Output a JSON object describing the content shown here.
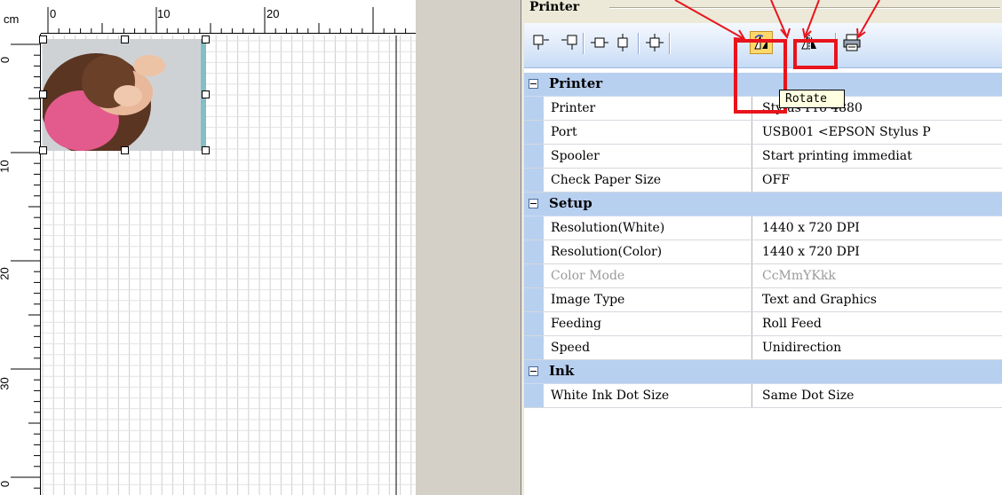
{
  "ruler": {
    "unit": "cm",
    "h_labels": [
      "0",
      "10",
      "20"
    ],
    "v_labels": [
      "0",
      "10",
      "20",
      "30",
      "0"
    ]
  },
  "panel": {
    "title": "Printer",
    "tooltip": "Rotate",
    "toolbar_icons": [
      "align-top-icon",
      "align-bottom-icon",
      "center-horizontal-icon",
      "center-vertical-icon",
      "center-both-icon",
      "rotate-icon",
      "mirror-icon",
      "print-icon"
    ],
    "categories": [
      {
        "label": "Printer",
        "rows": [
          {
            "name": "Printer",
            "value": "Stylus Pro 4880",
            "disabled": false
          },
          {
            "name": "Port",
            "value": "USB001   <EPSON Stylus P",
            "disabled": false
          },
          {
            "name": "Spooler",
            "value": "Start printing immediat",
            "disabled": false
          },
          {
            "name": "Check Paper Size",
            "value": "OFF",
            "disabled": false
          }
        ]
      },
      {
        "label": "Setup",
        "rows": [
          {
            "name": "Resolution(White)",
            "value": "1440 x 720 DPI",
            "disabled": false
          },
          {
            "name": "Resolution(Color)",
            "value": "1440 x 720 DPI",
            "disabled": false
          },
          {
            "name": "Color Mode",
            "value": "CcMmYKkk",
            "disabled": true
          },
          {
            "name": "Image Type",
            "value": "Text and Graphics",
            "disabled": false
          },
          {
            "name": "Feeding",
            "value": "Roll Feed",
            "disabled": false
          },
          {
            "name": "Speed",
            "value": "Unidirection",
            "disabled": false
          }
        ]
      },
      {
        "label": "Ink",
        "rows": [
          {
            "name": "White Ink Dot Size",
            "value": "Same Dot Size",
            "disabled": false
          }
        ]
      }
    ]
  },
  "colors": {
    "category_band": "#b8d0f0",
    "highlight_red": "#e8141c",
    "tooltip_bg": "#ffffe1",
    "active_button": "#ffd86b"
  }
}
